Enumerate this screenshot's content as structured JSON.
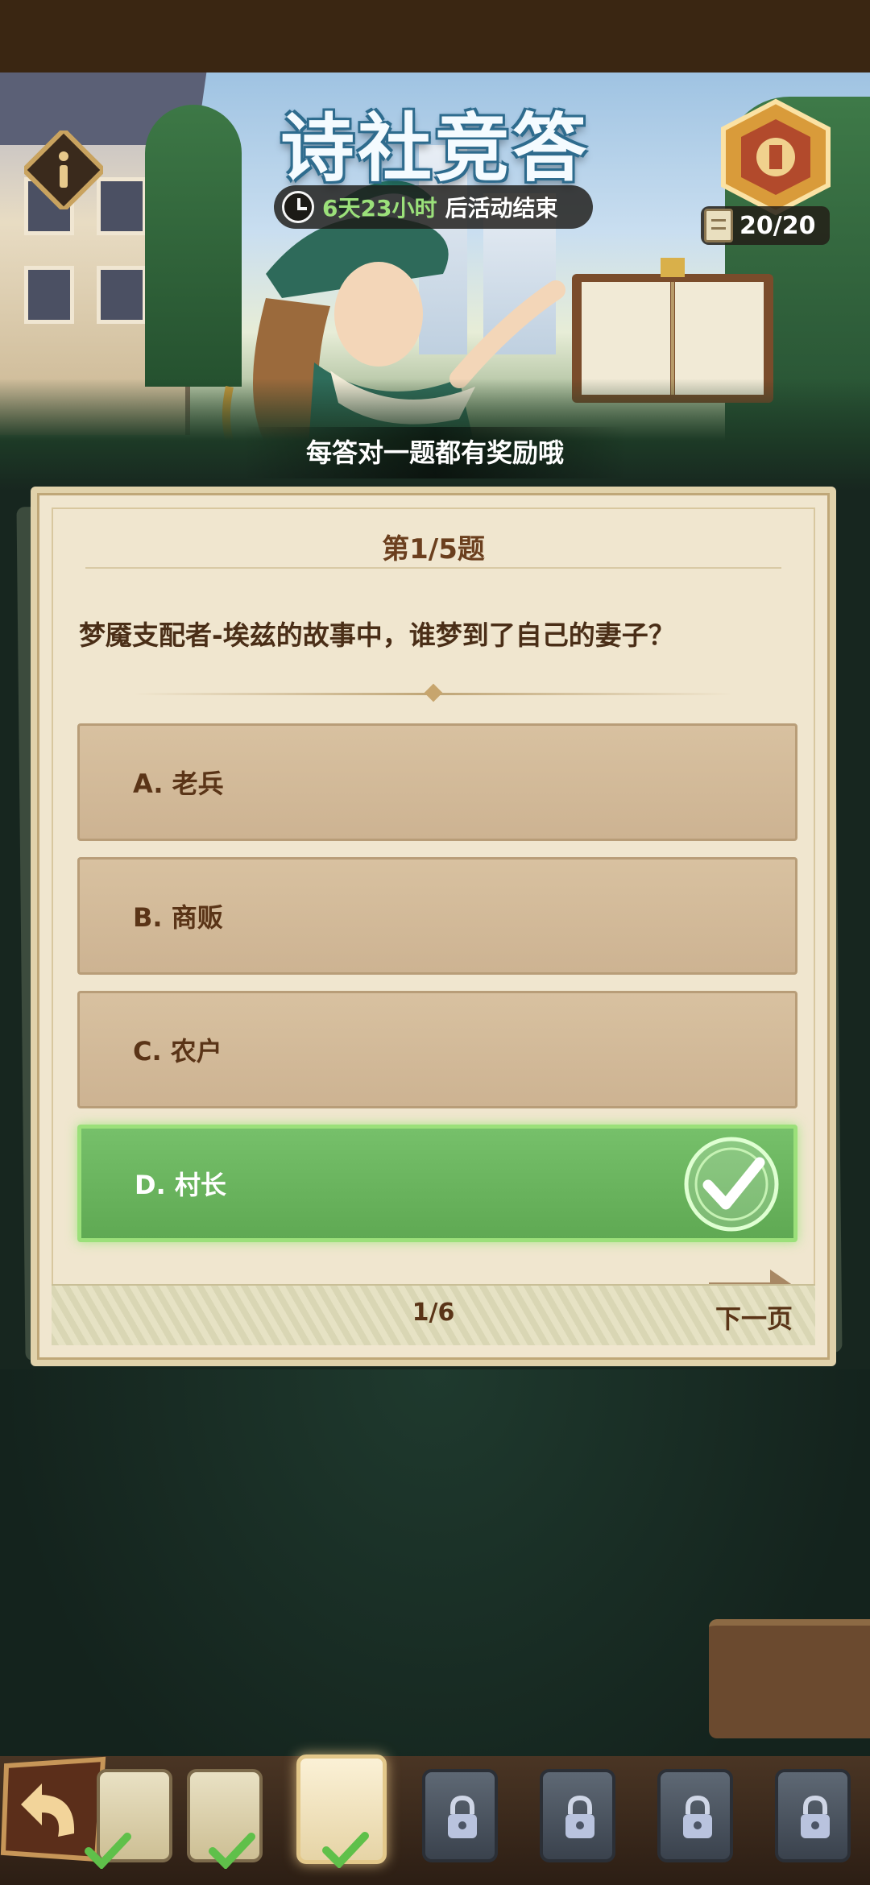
{
  "header": {
    "title": "诗社竞答",
    "timer_highlight": "6天23小时",
    "timer_suffix": "后活动结束",
    "quota": "20/20",
    "reward_tip": "每答对一题都有奖励哦"
  },
  "question": {
    "number_label": "第1/5题",
    "text": "梦魇支配者-埃兹的故事中，谁梦到了自己的妻子？",
    "options": [
      {
        "label": "A. 老兵",
        "state": "normal"
      },
      {
        "label": "B. 商贩",
        "state": "normal"
      },
      {
        "label": "C. 农户",
        "state": "normal"
      },
      {
        "label": "D. 村长",
        "state": "correct"
      }
    ]
  },
  "footer": {
    "page_indicator": "1/6",
    "next_label": "下一页"
  },
  "question_slots": [
    {
      "state": "done"
    },
    {
      "state": "done"
    },
    {
      "state": "current"
    },
    {
      "state": "locked"
    },
    {
      "state": "locked"
    },
    {
      "state": "locked"
    },
    {
      "state": "locked"
    }
  ],
  "colors": {
    "correct_green": "#6ab35d",
    "timer_green": "#9be07a",
    "text_brown": "#5a3417"
  }
}
